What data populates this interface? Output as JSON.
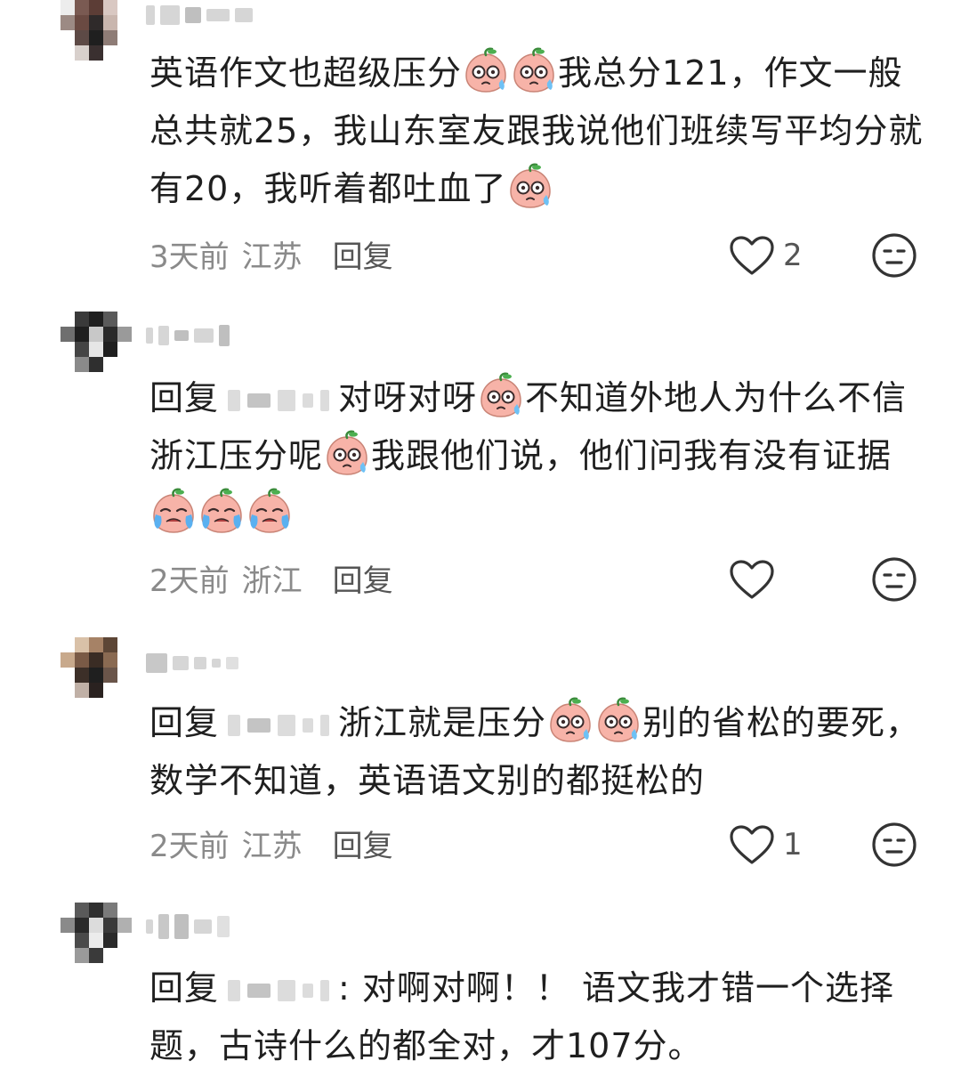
{
  "comments": [
    {
      "segments": [
        {
          "t": "英语作文也超级压分"
        },
        {
          "e": "sweat"
        },
        {
          "e": "sweat"
        },
        {
          "t": "我总分121，作文一般总共就25，我山东室友跟我说他们班续写平均分就有20，我听着都吐血了"
        },
        {
          "e": "sweat"
        }
      ],
      "time": "3天前",
      "region": "江苏",
      "reply_label": "回复",
      "likes": "2"
    },
    {
      "segments": [
        {
          "t": "回复"
        },
        {
          "m": true
        },
        {
          "t": "对呀对呀"
        },
        {
          "e": "sweat"
        },
        {
          "t": "不知道外地人为什么不信浙江压分呢"
        },
        {
          "e": "sweat"
        },
        {
          "t": "我跟他们说，他们问我有没有证据"
        },
        {
          "e": "cry"
        },
        {
          "e": "cry"
        },
        {
          "e": "cry"
        }
      ],
      "time": "2天前",
      "region": "浙江",
      "reply_label": "回复",
      "likes": ""
    },
    {
      "segments": [
        {
          "t": "回复"
        },
        {
          "m": true
        },
        {
          "t": "浙江就是压分"
        },
        {
          "e": "sweat"
        },
        {
          "e": "sweat"
        },
        {
          "t": "别的省松的要死，数学不知道，英语语文别的都挺松的"
        }
      ],
      "time": "2天前",
      "region": "江苏",
      "reply_label": "回复",
      "likes": "1"
    },
    {
      "segments": [
        {
          "t": "回复"
        },
        {
          "m": true
        },
        {
          "t": ": 对啊对啊！！ 语文我才错一个选择题，古诗什么的都全对，才107分。"
        }
      ],
      "time": "",
      "region": "",
      "reply_label": "",
      "likes": ""
    }
  ],
  "icons": {
    "like": "heart-outline-icon",
    "dislike": "meh-face-icon",
    "emoji_sweat": "peach-sweat-emoji",
    "emoji_cry": "peach-cry-emoji"
  },
  "colors": {
    "text": "#1f1f1f",
    "meta": "#8a8a8a",
    "icon": "#333333",
    "emoji_face": "#f7b3a8"
  }
}
